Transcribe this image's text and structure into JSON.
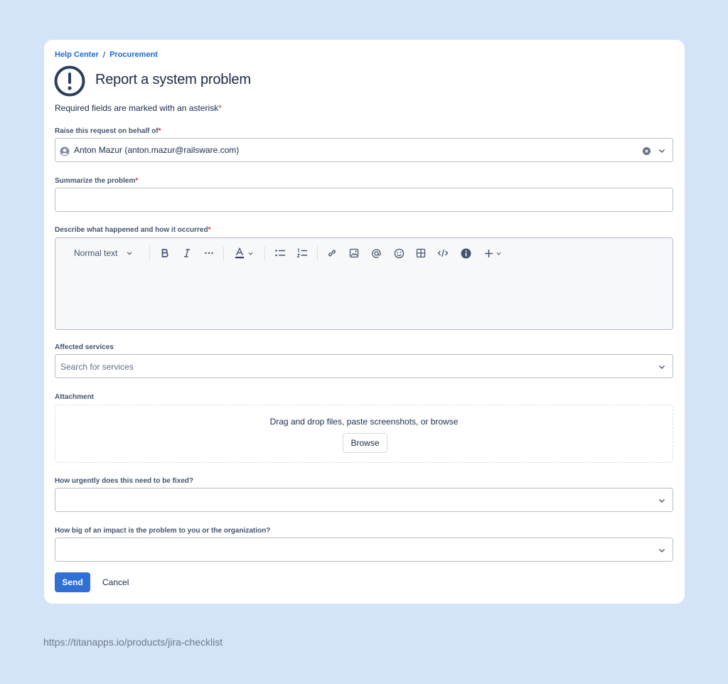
{
  "breadcrumb": {
    "items": [
      "Help Center",
      "Procurement"
    ],
    "separator": "/"
  },
  "page": {
    "title": "Report a system problem",
    "required_note": "Required fields are marked with an asterisk",
    "asterisk": "*"
  },
  "fields": {
    "behalf": {
      "label": "Raise this request on behalf of",
      "value": "Anton Mazur (anton.mazur@railsware.com)"
    },
    "summary": {
      "label": "Summarize the problem",
      "value": ""
    },
    "description": {
      "label": "Describe what happened and how it occurred",
      "text_style": "Normal text"
    },
    "services": {
      "label": "Affected services",
      "placeholder": "Search for services"
    },
    "attachment": {
      "label": "Attachment",
      "drop_text": "Drag and drop files, paste screenshots, or browse",
      "browse_label": "Browse"
    },
    "urgency": {
      "label": "How urgently does this need to be fixed?",
      "value": ""
    },
    "impact": {
      "label": "How big of an impact is the problem to you or the organization?",
      "value": ""
    }
  },
  "actions": {
    "send_label": "Send",
    "cancel_label": "Cancel"
  },
  "footer": {
    "url": "https://titanapps.io/products/jira-checklist"
  },
  "colors": {
    "background": "#d3e3f8",
    "accent": "#2f6fd6",
    "link": "#1d6ad4",
    "required": "#c9372c"
  },
  "icons": [
    "exclamation-circle-icon",
    "user-avatar-icon",
    "clear-icon",
    "chevron-down-icon",
    "bold-icon",
    "italic-icon",
    "more-icon",
    "text-color-icon",
    "bullet-list-icon",
    "numbered-list-icon",
    "link-icon",
    "image-icon",
    "mention-icon",
    "emoji-icon",
    "table-icon",
    "code-icon",
    "info-icon",
    "plus-icon"
  ]
}
